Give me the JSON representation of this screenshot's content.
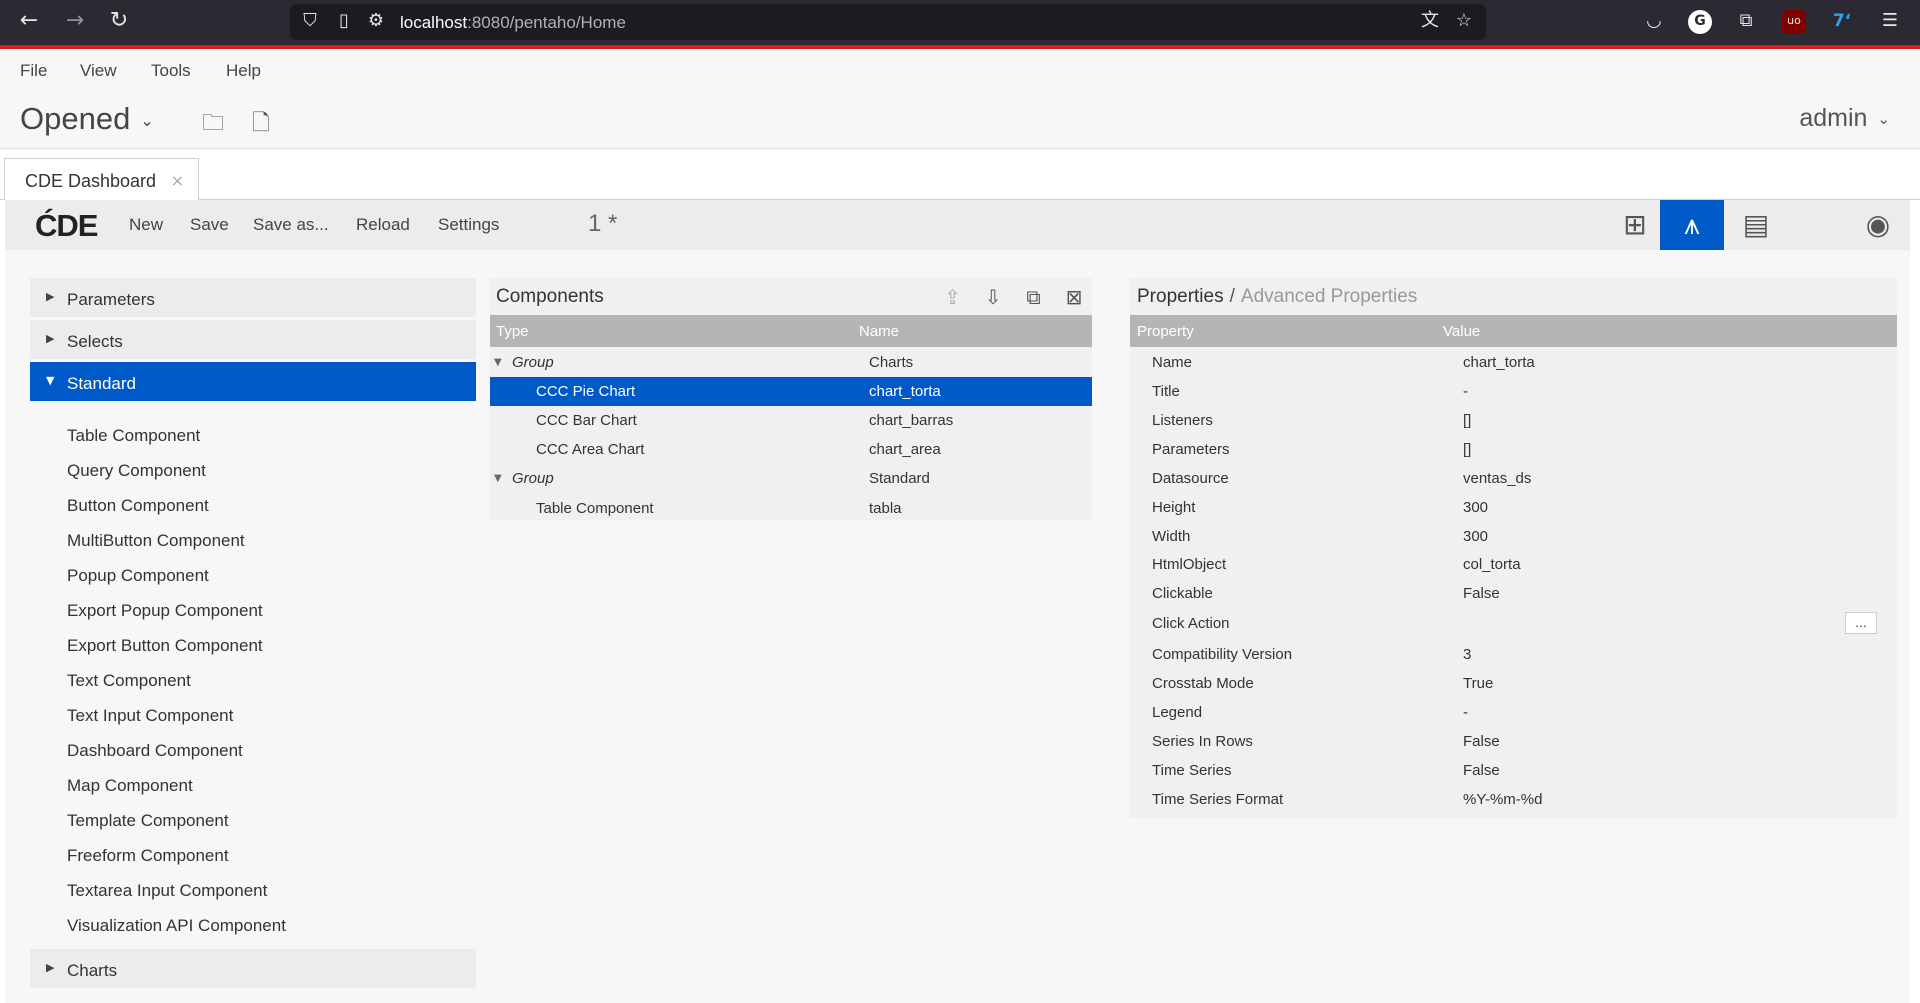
{
  "browser": {
    "url_host": "localhost",
    "url_rest": ":8080/pentaho/Home"
  },
  "menu": {
    "items": [
      "File",
      "View",
      "Tools",
      "Help"
    ],
    "perspective": "Opened",
    "user": "admin"
  },
  "tab": {
    "label": "CDE Dashboard",
    "close": "×"
  },
  "cde_toolbar": {
    "logo": "ĆDE",
    "buttons": [
      "New",
      "Save",
      "Save as...",
      "Reload",
      "Settings"
    ],
    "counter": "1 *"
  },
  "left_panel": {
    "sections": [
      {
        "label": "Parameters",
        "expanded": false
      },
      {
        "label": "Selects",
        "expanded": false
      },
      {
        "label": "Standard",
        "expanded": true
      },
      {
        "label": "Charts",
        "expanded": false
      }
    ],
    "standard_items": [
      "Table Component",
      "Query Component",
      "Button Component",
      "MultiButton Component",
      "Popup Component",
      "Export Popup Component",
      "Export Button Component",
      "Text Component",
      "Text Input Component",
      "Dashboard Component",
      "Map Component",
      "Template Component",
      "Freeform Component",
      "Textarea Input Component",
      "Visualization API Component"
    ]
  },
  "components": {
    "title": "Components",
    "col_type": "Type",
    "col_name": "Name",
    "rows": [
      {
        "type": "Group",
        "name": "Charts",
        "group": true
      },
      {
        "type": "CCC Pie Chart",
        "name": "chart_torta",
        "selected": true
      },
      {
        "type": "CCC Bar Chart",
        "name": "chart_barras"
      },
      {
        "type": "CCC Area Chart",
        "name": "chart_area"
      },
      {
        "type": "Group",
        "name": "Standard",
        "group": true
      },
      {
        "type": "Table Component",
        "name": "tabla"
      }
    ]
  },
  "properties": {
    "title": "Properties",
    "sep": "/",
    "advanced": "Advanced Properties",
    "col_property": "Property",
    "col_value": "Value",
    "ellipsis": "...",
    "rows": [
      {
        "k": "Name",
        "v": "chart_torta"
      },
      {
        "k": "Title",
        "v": "-"
      },
      {
        "k": "Listeners",
        "v": "[]"
      },
      {
        "k": "Parameters",
        "v": "[]"
      },
      {
        "k": "Datasource",
        "v": "ventas_ds"
      },
      {
        "k": "Height",
        "v": "300"
      },
      {
        "k": "Width",
        "v": "300"
      },
      {
        "k": "HtmlObject",
        "v": "col_torta"
      },
      {
        "k": "Clickable",
        "v": "False"
      },
      {
        "k": "Click Action",
        "v": ""
      },
      {
        "k": "Compatibility Version",
        "v": "3"
      },
      {
        "k": "Crosstab Mode",
        "v": "True"
      },
      {
        "k": "Legend",
        "v": "-"
      },
      {
        "k": "Series In Rows",
        "v": "False"
      },
      {
        "k": "Time Series",
        "v": "False"
      },
      {
        "k": "Time Series Format",
        "v": "%Y-%m-%d"
      }
    ]
  },
  "colors": {
    "accent": "#0059c9",
    "browser_bg": "#2b2a33",
    "red_line": "#d81e1e"
  }
}
